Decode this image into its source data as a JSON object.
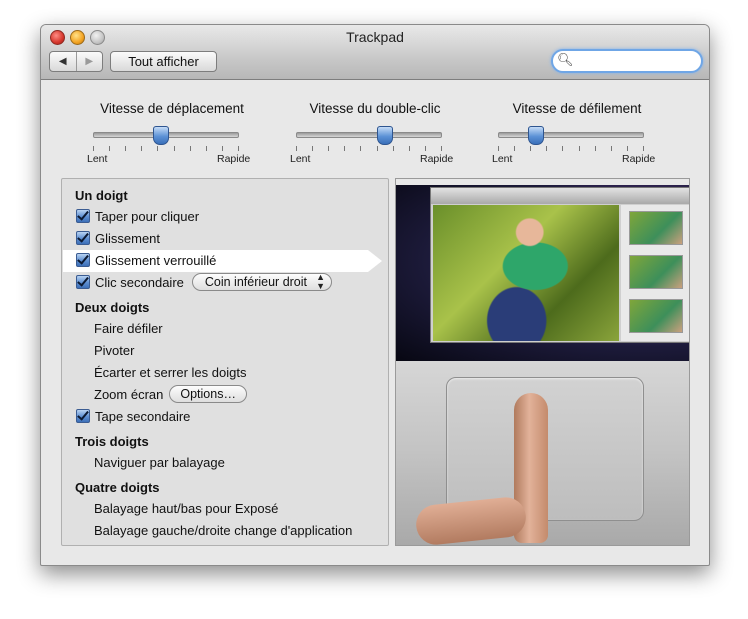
{
  "window": {
    "title": "Trackpad"
  },
  "toolbar": {
    "back_icon": "◀",
    "forward_icon": "▶",
    "show_all_label": "Tout afficher",
    "search_icon": "magnifier-icon",
    "search_value": "",
    "search_placeholder": ""
  },
  "sliders": [
    {
      "title": "Vitesse de déplacement",
      "min_label": "Lent",
      "max_label": "Rapide",
      "value_fraction": 0.46,
      "tick_count": 10
    },
    {
      "title": "Vitesse du double-clic",
      "min_label": "Lent",
      "max_label": "Rapide",
      "value_fraction": 0.6,
      "tick_count": 10
    },
    {
      "title": "Vitesse de défilement",
      "min_label": "Lent",
      "max_label": "Rapide",
      "value_fraction": 0.25,
      "tick_count": 10
    }
  ],
  "gestures": {
    "one_finger": {
      "title": "Un doigt",
      "tap_to_click": {
        "label": "Taper pour cliquer",
        "checked": true
      },
      "dragging": {
        "label": "Glissement",
        "checked": true
      },
      "drag_lock": {
        "label": "Glissement verrouillé",
        "checked": true
      },
      "secondary_click": {
        "label": "Clic secondaire",
        "checked": true,
        "popup_value": "Coin inférieur droit"
      }
    },
    "two_fingers": {
      "title": "Deux doigts",
      "scroll": {
        "label": "Faire défiler"
      },
      "rotate": {
        "label": "Pivoter"
      },
      "pinch": {
        "label": "Écarter et serrer les doigts"
      },
      "screen_zoom": {
        "label": "Zoom écran",
        "button_label": "Options…"
      },
      "secondary_tap": {
        "label": "Tape secondaire",
        "checked": true
      }
    },
    "three_fingers": {
      "title": "Trois doigts",
      "swipe": {
        "label": "Naviguer par balayage"
      }
    },
    "four_fingers": {
      "title": "Quatre doigts",
      "expose": {
        "label": "Balayage haut/bas pour Exposé"
      },
      "switch_app": {
        "label": "Balayage gauche/droite change d'application"
      }
    }
  },
  "colors": {
    "accent": "#5c92d6",
    "window_bg": "#e8e8e8",
    "selected_row": "#ffffff"
  }
}
